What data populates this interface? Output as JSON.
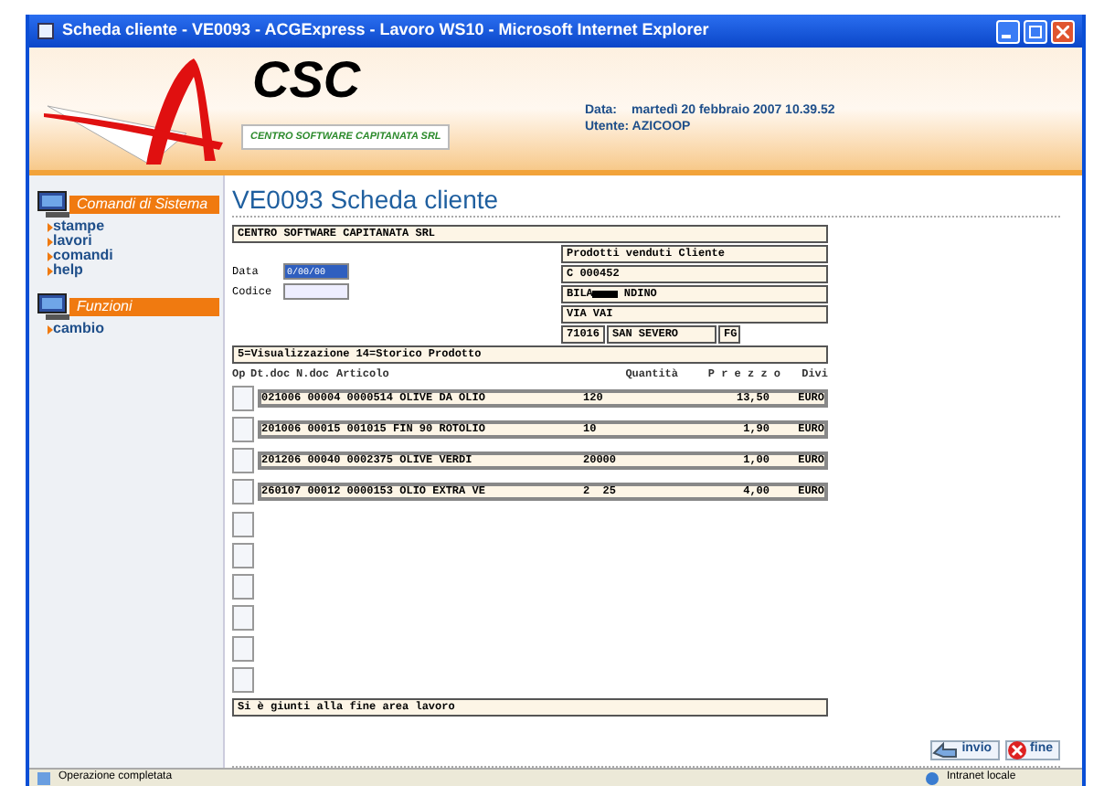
{
  "window": {
    "title": "Scheda cliente - VE0093 - ACGExpress - Lavoro WS10 - Microsoft Internet Explorer"
  },
  "header": {
    "logo": "CSC",
    "company": "CENTRO SOFTWARE CAPITANATA SRL",
    "date_label": "Data:",
    "date_value": "martedì 20 febbraio 2007 10.39.52",
    "user": "Utente: AZICOOP"
  },
  "sidebar": {
    "sections": [
      {
        "title": "Comandi di Sistema",
        "items": [
          "stampe",
          "lavori",
          "comandi",
          "help"
        ]
      },
      {
        "title": "Funzioni",
        "items": [
          "cambio"
        ]
      }
    ]
  },
  "page": {
    "title": "VE0093 Scheda cliente",
    "company_line": "CENTRO SOFTWARE CAPITANATA SRL",
    "fields": [
      {
        "label": "Data",
        "value": "0/00/00"
      },
      {
        "label": "Codice"
      }
    ],
    "customer": {
      "heading": "Prodotti venduti Cliente",
      "code": "C 000452",
      "name_start": "BILA",
      "name_end": "NDINO",
      "address": "VIA VAI",
      "zip": "71016",
      "city": "SAN SEVERO",
      "province": "FG"
    },
    "options": "5=Visualizzazione  14=Storico Prodotto",
    "table": {
      "columns": [
        "Op",
        "Dt.doc",
        "N.doc",
        "Articolo",
        "Quantità",
        "P r e z z o",
        "Divi"
      ],
      "rows": [
        {
          "article": "021006 00004 0000514 OLIVE DA OLIO",
          "qty": "120",
          "price": "13,50",
          "currency": "EURO"
        },
        {
          "article": "201006 00015 001015 FIN 90 ROTOLIO",
          "qty": "10",
          "price": "1,90",
          "currency": "EURO"
        },
        {
          "article": "201206 00040 0002375 OLIVE VERDI",
          "qty": "20000",
          "price": "1,00",
          "currency": "EURO"
        },
        {
          "article": "260107 00012 0000153 OLIO EXTRA VE",
          "qty": "2  25",
          "price": "4,00",
          "currency": "EURO"
        }
      ]
    },
    "message": "Si è giunti alla fine area lavoro",
    "buttons": [
      "invio",
      "fine"
    ]
  },
  "status_bar": {
    "left": "Operazione completata",
    "right": "Intranet locale"
  }
}
